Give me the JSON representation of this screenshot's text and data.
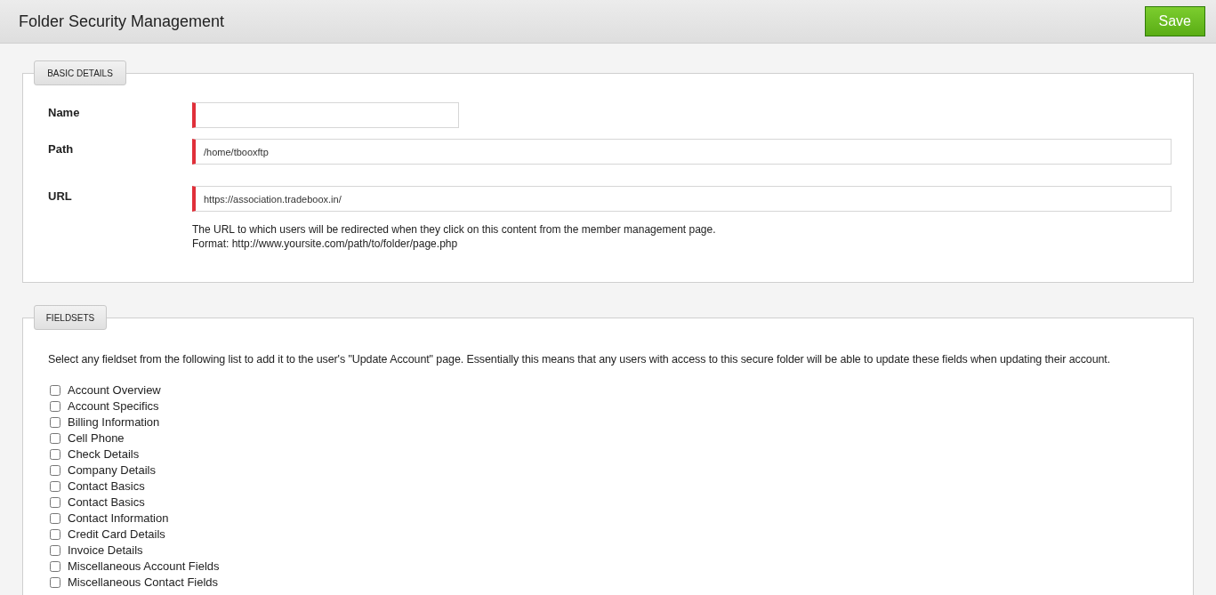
{
  "header": {
    "title": "Folder Security Management",
    "save_button": "Save"
  },
  "basic_details": {
    "legend": "BASIC DETAILS",
    "fields": [
      {
        "label": "Name",
        "required": true,
        "kind": "short"
      },
      {
        "label": "Path",
        "value": "/home/tbooxftp",
        "required": true,
        "kind": "wide"
      },
      {
        "label": "URL",
        "value": "https://association.tradeboox.in/",
        "required": true,
        "kind": "wide",
        "help": [
          "The URL to which users will be redirected when they click on this content from the member management page.",
          "Format: http://www.yoursite.com/path/to/folder/page.php"
        ]
      }
    ]
  },
  "fieldsets": {
    "legend": "FIELDSETS",
    "description": "Select any fieldset from the following list to add it to the user's \"Update Account\" page. Essentially this means that any users with access to this secure folder will be able to update these fields when updating their account.",
    "items": [
      {
        "label": "Account Overview",
        "checked": false
      },
      {
        "label": "Account Specifics",
        "checked": false
      },
      {
        "label": "Billing Information",
        "checked": false
      },
      {
        "label": "Cell Phone",
        "checked": false
      },
      {
        "label": "Check Details",
        "checked": false
      },
      {
        "label": "Company Details",
        "checked": false
      },
      {
        "label": "Contact Basics",
        "checked": false
      },
      {
        "label": "Contact Basics",
        "checked": false
      },
      {
        "label": "Contact Information",
        "checked": false
      },
      {
        "label": "Credit Card Details",
        "checked": false
      },
      {
        "label": "Invoice Details",
        "checked": false
      },
      {
        "label": "Miscellaneous Account Fields",
        "checked": false
      },
      {
        "label": "Miscellaneous Contact Fields",
        "checked": false
      }
    ]
  }
}
